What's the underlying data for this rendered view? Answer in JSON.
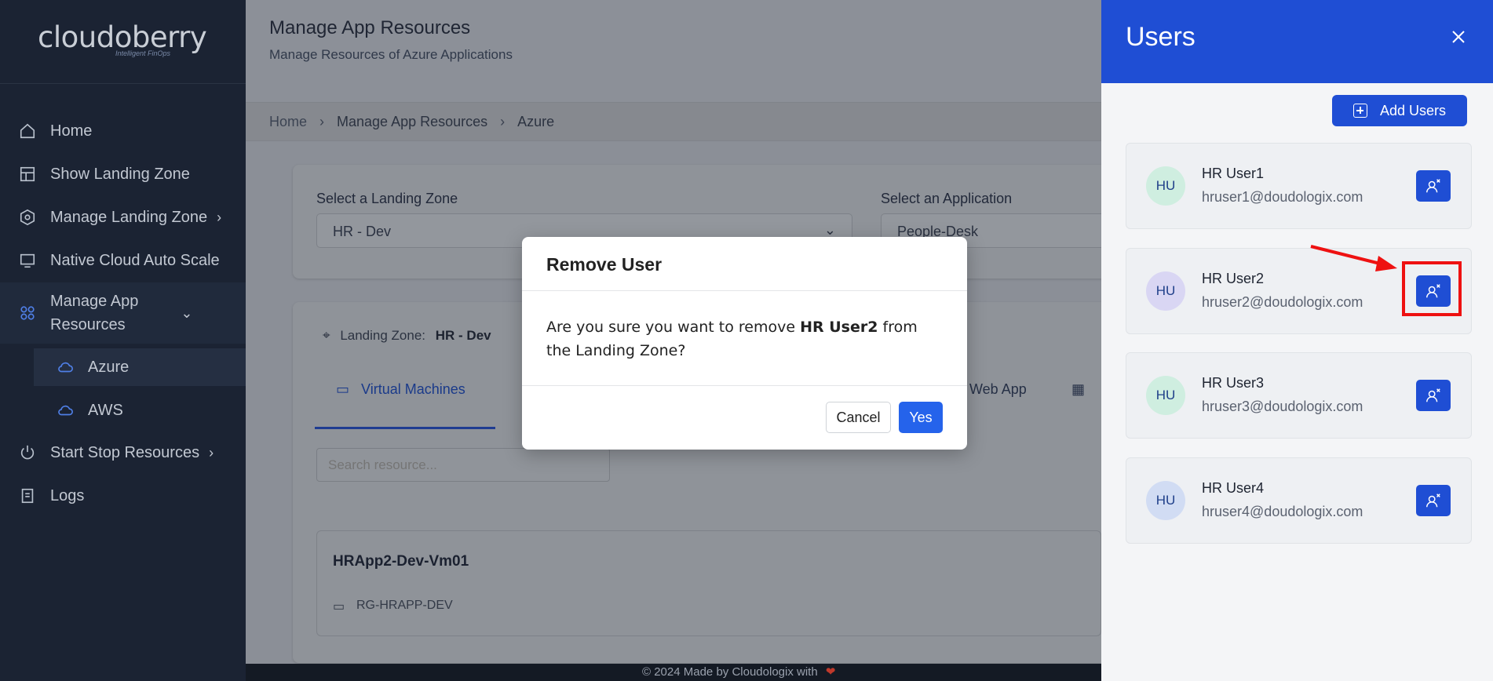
{
  "sidebar": {
    "brand": "cloudoberry",
    "tagline": "Intelligent FinOps",
    "items": [
      {
        "label": "Home"
      },
      {
        "label": "Show Landing Zone"
      },
      {
        "label": "Manage Landing Zone"
      },
      {
        "label": "Native Cloud Auto Scale"
      },
      {
        "label": "Manage App",
        "label2": "Resources"
      },
      {
        "label": "Azure"
      },
      {
        "label": "AWS"
      },
      {
        "label": "Start Stop Resources"
      },
      {
        "label": "Logs"
      }
    ]
  },
  "header": {
    "title": "Manage App Resources",
    "subtitle": "Manage Resources of Azure Applications"
  },
  "breadcrumb": [
    "Home",
    "Manage App Resources",
    "Azure"
  ],
  "selectors": {
    "landing_zone_label": "Select a Landing Zone",
    "landing_zone_value": "HR - Dev",
    "application_label": "Select an Application",
    "application_value": "People-Desk"
  },
  "info": {
    "landing_zone_label": "Landing Zone:",
    "landing_zone_value": "HR - Dev"
  },
  "tabs": {
    "vm": "Virtual Machines",
    "webapp": "Web App"
  },
  "search": {
    "placeholder": "Search resource..."
  },
  "vm": {
    "name": "HRApp2-Dev-Vm01",
    "resource_group": "RG-HRAPP-DEV"
  },
  "footer": {
    "text": "© 2024 Made by Cloudologix with"
  },
  "modal": {
    "title": "Remove User",
    "body_prefix": "Are you sure you want to remove ",
    "body_user": "HR User2",
    "body_suffix": " from the Landing Zone?",
    "cancel": "Cancel",
    "yes": "Yes"
  },
  "panel": {
    "title": "Users",
    "add_button": "Add Users",
    "users": [
      {
        "initials": "HU",
        "name": "HR User1",
        "email": "hruser1@doudologix.com",
        "avatar_color": "#cfeee0"
      },
      {
        "initials": "HU",
        "name": "HR User2",
        "email": "hruser2@doudologix.com",
        "avatar_color": "#d9d6f3"
      },
      {
        "initials": "HU",
        "name": "HR User3",
        "email": "hruser3@doudologix.com",
        "avatar_color": "#cfeee0"
      },
      {
        "initials": "HU",
        "name": "HR User4",
        "email": "hruser4@doudologix.com",
        "avatar_color": "#d1dcf3"
      }
    ]
  },
  "colors": {
    "accent": "#1f4ed4",
    "yes_button": "#2563eb",
    "highlight": "#e11111"
  }
}
